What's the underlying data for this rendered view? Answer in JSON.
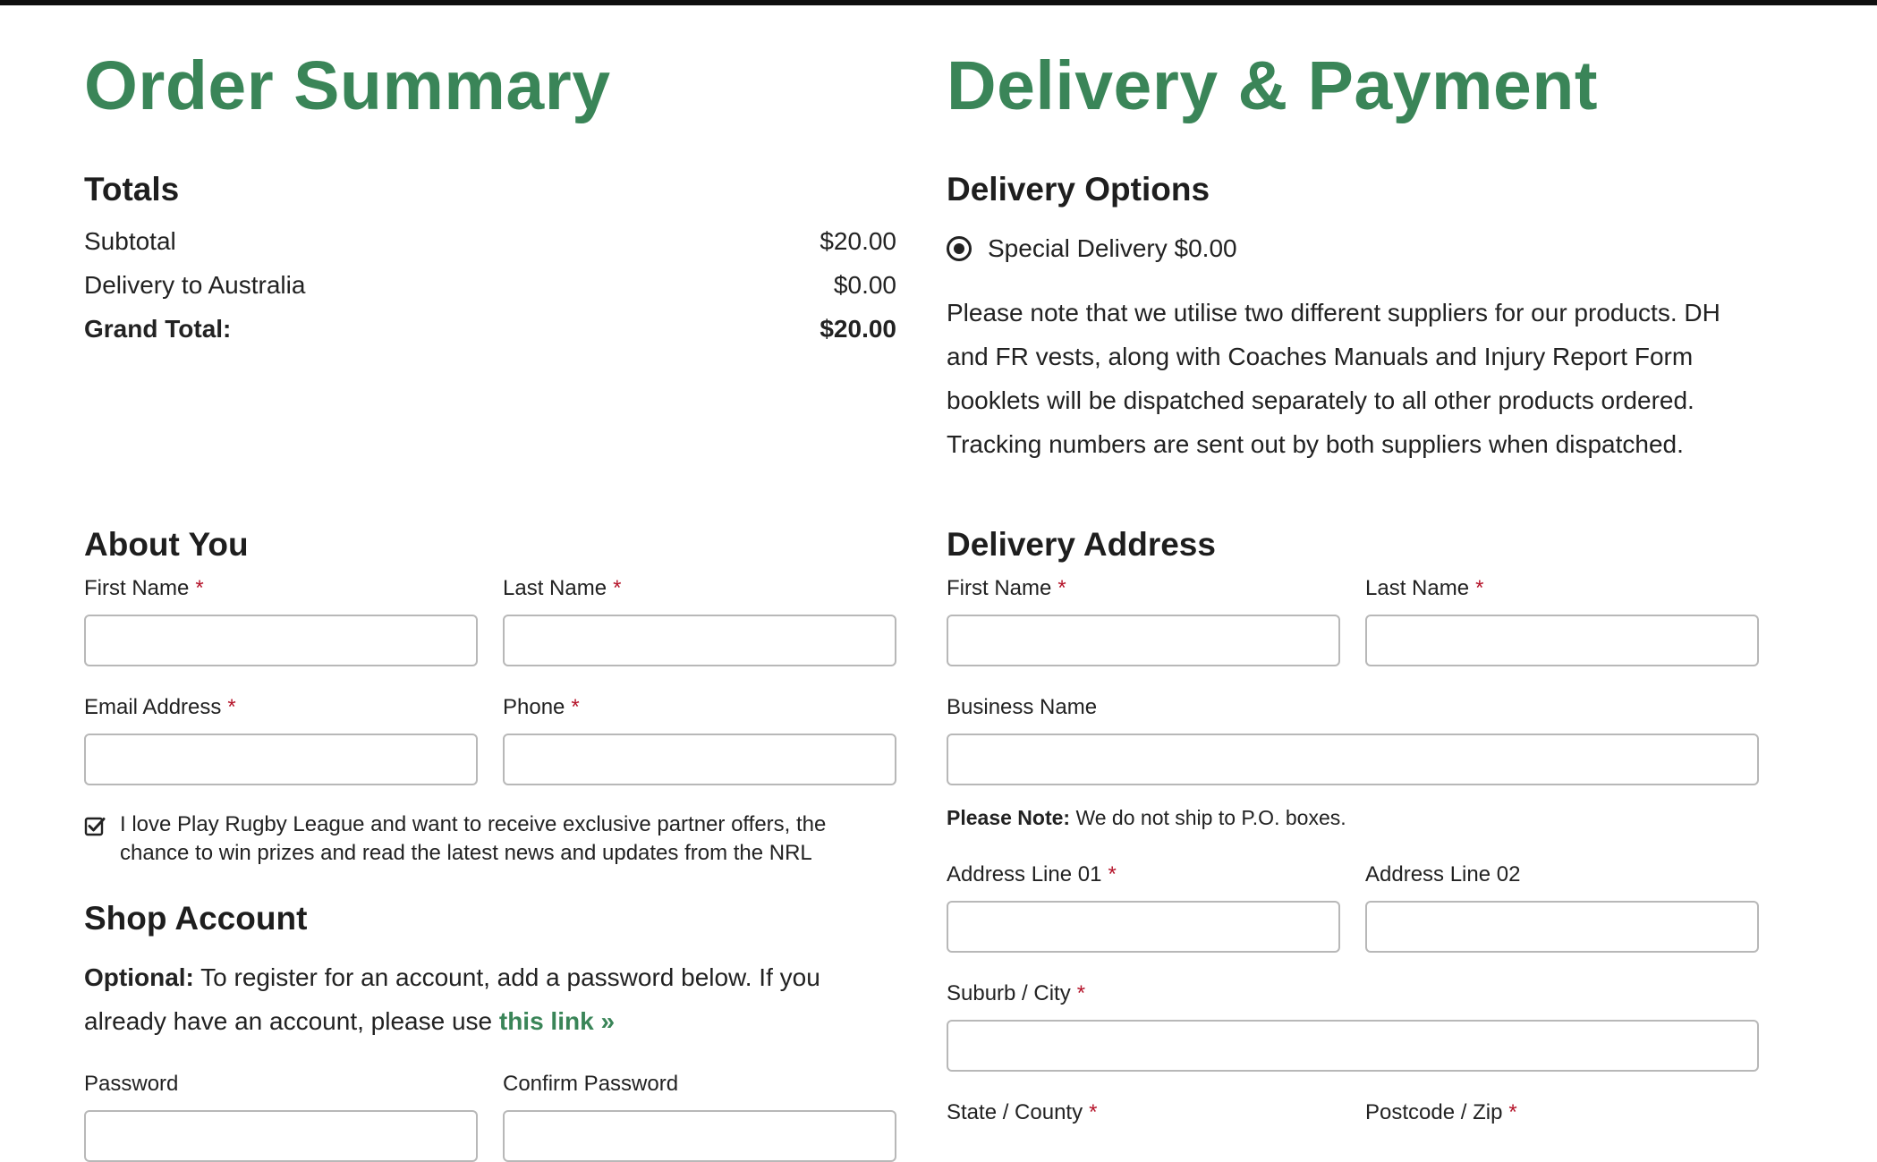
{
  "order_summary": {
    "title": "Order Summary",
    "totals_heading": "Totals",
    "rows": [
      {
        "label": "Subtotal",
        "value": "$20.00"
      },
      {
        "label": "Delivery to Australia",
        "value": "$0.00"
      },
      {
        "label": "Grand Total:",
        "value": "$20.00"
      }
    ]
  },
  "about_you": {
    "heading": "About You",
    "first_name_label": "First Name",
    "last_name_label": "Last Name",
    "email_label": "Email Address",
    "phone_label": "Phone",
    "required_mark": "*",
    "newsletter_checked": true,
    "newsletter_text": "I love Play Rugby League and want to receive exclusive partner offers, the chance to win prizes and read the latest news and updates from the NRL"
  },
  "shop_account": {
    "heading": "Shop Account",
    "optional_label": "Optional:",
    "optional_text": "To register for an account, add a password below. If you already have an account, please use",
    "link_text": "this link »",
    "password_label": "Password",
    "confirm_password_label": "Confirm Password"
  },
  "delivery_payment": {
    "title": "Delivery & Payment",
    "options_heading": "Delivery Options",
    "option_label": "Special Delivery $0.00",
    "option_selected": true,
    "notice": "Please note that we utilise two different suppliers for our products. DH and FR vests, along with Coaches Manuals and Injury Report Form booklets will be dispatched separately to all other products ordered. Tracking numbers are sent out by both suppliers when dispatched."
  },
  "delivery_address": {
    "heading": "Delivery Address",
    "first_name_label": "First Name",
    "last_name_label": "Last Name",
    "business_name_label": "Business Name",
    "note_label": "Please Note:",
    "note_text": "We do not ship to P.O. boxes.",
    "address1_label": "Address Line 01",
    "address2_label": "Address Line 02",
    "city_label": "Suburb / City",
    "state_label": "State / County",
    "postcode_label": "Postcode / Zip"
  },
  "colors": {
    "accent_green": "#3a8558",
    "required_red": "#b5142a",
    "input_border": "#b8b8b8"
  }
}
